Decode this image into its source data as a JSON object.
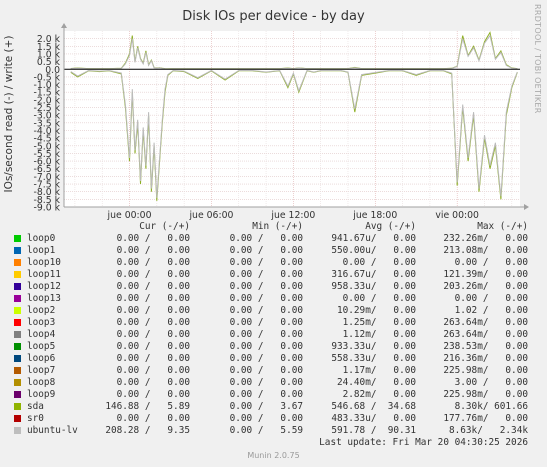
{
  "chart_data": {
    "type": "line",
    "title": "Disk IOs per device - by day",
    "ylabel": "IOs/second read (-) / write (+)",
    "y_ticks": [
      "2.0 k",
      "1.5 k",
      "1.0 k",
      "0.5 k",
      "0.0",
      "-0.5 k",
      "-1.0 k",
      "-1.5 k",
      "-2.0 k",
      "-2.5 k",
      "-3.0 k",
      "-3.5 k",
      "-4.0 k",
      "-4.5 k",
      "-5.0 k",
      "-5.5 k",
      "-6.0 k",
      "-6.5 k",
      "-7.0 k",
      "-7.5 k",
      "-8.0 k",
      "-8.5 k",
      "-9.0 k"
    ],
    "ylim": [
      -9000,
      2500
    ],
    "x_ticks": [
      "jue 00:00",
      "jue 06:00",
      "jue 12:00",
      "jue 18:00",
      "vie 00:00"
    ],
    "x_tick_hours": [
      0,
      6,
      12,
      18,
      24
    ],
    "xlim_hours": [
      -4.8,
      28.6
    ],
    "grid": true,
    "series": [
      {
        "name": "sda",
        "color": "#8fb026",
        "x_hours": [
          -4.3,
          -3.8,
          -3.0,
          -2.2,
          -1.5,
          -0.6,
          -0.3,
          0.0,
          0.2,
          0.4,
          0.6,
          0.8,
          1.0,
          1.2,
          1.4,
          1.6,
          1.8,
          2.0,
          2.2,
          2.4,
          2.6,
          2.8,
          3.2,
          4.0,
          5.0,
          6.0,
          7.0,
          8.0,
          9.0,
          10.0,
          11.0,
          11.6,
          12.0,
          12.4,
          13.0,
          13.5,
          14.0,
          15.5,
          16.0,
          16.5,
          17.0,
          19.0,
          20.0,
          21.0,
          22.0,
          23.0,
          23.6,
          24.0,
          24.4,
          24.8,
          25.2,
          25.6,
          26.0,
          26.4,
          26.8,
          27.2,
          27.6,
          28.0,
          28.4
        ],
        "read": [
          -200,
          -500,
          -100,
          -150,
          -100,
          -300,
          -2500,
          -6000,
          -1500,
          -5500,
          -3500,
          -7500,
          -4000,
          -6500,
          -3000,
          -8000,
          -5000,
          -8600,
          -6000,
          -3500,
          -1500,
          -400,
          -100,
          -150,
          -600,
          -100,
          -700,
          -100,
          -100,
          -200,
          -100,
          -1200,
          -300,
          -1500,
          -100,
          -200,
          -100,
          -100,
          -200,
          -2800,
          -400,
          -100,
          -100,
          -400,
          -100,
          -100,
          -300,
          -7600,
          -2500,
          -6000,
          -3000,
          -8000,
          -4500,
          -6500,
          -5000,
          -8500,
          -3000,
          -1200,
          -200
        ],
        "write": [
          50,
          80,
          40,
          40,
          40,
          60,
          400,
          1000,
          2200,
          500,
          1500,
          700,
          400,
          1200,
          300,
          600,
          100,
          80,
          100,
          60,
          40,
          30,
          40,
          40,
          40,
          40,
          40,
          40,
          40,
          40,
          40,
          80,
          40,
          90,
          40,
          50,
          40,
          40,
          40,
          120,
          40,
          40,
          40,
          40,
          40,
          40,
          60,
          200,
          2200,
          900,
          1500,
          600,
          1800,
          2400,
          700,
          1200,
          300,
          80,
          40
        ]
      },
      {
        "name": "ubuntu-lv",
        "color": "#bbbbbb",
        "x_hours": [
          -4.3,
          -3.8,
          -3.0,
          -2.2,
          -1.5,
          -0.6,
          -0.3,
          0.0,
          0.2,
          0.4,
          0.6,
          0.8,
          1.0,
          1.2,
          1.4,
          1.6,
          1.8,
          2.0,
          2.2,
          2.4,
          2.6,
          2.8,
          3.2,
          4.0,
          5.0,
          6.0,
          7.0,
          8.0,
          9.0,
          10.0,
          11.0,
          11.6,
          12.0,
          12.4,
          13.0,
          13.5,
          14.0,
          15.5,
          16.0,
          16.5,
          17.0,
          19.0,
          20.0,
          21.0,
          22.0,
          23.0,
          23.6,
          24.0,
          24.4,
          24.8,
          25.2,
          25.6,
          26.0,
          26.4,
          26.8,
          27.2,
          27.6,
          28.0,
          28.4
        ],
        "read": [
          -150,
          -450,
          -80,
          -120,
          -80,
          -250,
          -2300,
          -5800,
          -1300,
          -5300,
          -3300,
          -7300,
          -3800,
          -6300,
          -2800,
          -7800,
          -4800,
          -8400,
          -5800,
          -3300,
          -1300,
          -350,
          -80,
          -120,
          -550,
          -80,
          -650,
          -80,
          -80,
          -180,
          -80,
          -1100,
          -250,
          -1400,
          -80,
          -180,
          -80,
          -80,
          -180,
          -2600,
          -350,
          -80,
          -80,
          -350,
          -80,
          -80,
          -250,
          -7400,
          -2300,
          -5800,
          -2800,
          -7800,
          -4300,
          -6300,
          -4800,
          -8300,
          -2800,
          -1100,
          -180
        ],
        "write": [
          40,
          70,
          30,
          30,
          30,
          50,
          350,
          900,
          2000,
          450,
          1400,
          650,
          350,
          1100,
          250,
          550,
          90,
          70,
          90,
          50,
          30,
          20,
          30,
          30,
          30,
          30,
          30,
          30,
          30,
          30,
          30,
          70,
          30,
          80,
          30,
          40,
          30,
          30,
          30,
          100,
          30,
          30,
          30,
          30,
          30,
          30,
          50,
          180,
          2000,
          850,
          1400,
          550,
          1700,
          2200,
          650,
          1100,
          250,
          70,
          30
        ]
      }
    ]
  },
  "legend": {
    "headers": {
      "cur": "Cur (-/+)",
      "min": "Min (-/+)",
      "avg": "Avg (-/+)",
      "max": "Max (-/+)"
    },
    "rows": [
      {
        "name": "loop0",
        "color": "#00cc00",
        "cur": "0.00 /   0.00",
        "min": "0.00 /   0.00",
        "avg": "941.67u/   0.00",
        "max": "232.26m/   0.00"
      },
      {
        "name": "loop1",
        "color": "#0066b3",
        "cur": "0.00 /   0.00",
        "min": "0.00 /   0.00",
        "avg": "550.00u/   0.00",
        "max": "213.08m/   0.00"
      },
      {
        "name": "loop10",
        "color": "#ff8000",
        "cur": "0.00 /   0.00",
        "min": "0.00 /   0.00",
        "avg": "0.00 /   0.00",
        "max": "0.00 /   0.00"
      },
      {
        "name": "loop11",
        "color": "#ffcc00",
        "cur": "0.00 /   0.00",
        "min": "0.00 /   0.00",
        "avg": "316.67u/   0.00",
        "max": "121.39m/   0.00"
      },
      {
        "name": "loop12",
        "color": "#330099",
        "cur": "0.00 /   0.00",
        "min": "0.00 /   0.00",
        "avg": "958.33u/   0.00",
        "max": "203.26m/   0.00"
      },
      {
        "name": "loop13",
        "color": "#990099",
        "cur": "0.00 /   0.00",
        "min": "0.00 /   0.00",
        "avg": "0.00 /   0.00",
        "max": "0.00 /   0.00"
      },
      {
        "name": "loop2",
        "color": "#ccff00",
        "cur": "0.00 /   0.00",
        "min": "0.00 /   0.00",
        "avg": "10.29m/   0.00",
        "max": "1.02 /   0.00"
      },
      {
        "name": "loop3",
        "color": "#ff0000",
        "cur": "0.00 /   0.00",
        "min": "0.00 /   0.00",
        "avg": "1.25m/   0.00",
        "max": "263.64m/   0.00"
      },
      {
        "name": "loop4",
        "color": "#808080",
        "cur": "0.00 /   0.00",
        "min": "0.00 /   0.00",
        "avg": "1.12m/   0.00",
        "max": "263.64m/   0.00"
      },
      {
        "name": "loop5",
        "color": "#008f00",
        "cur": "0.00 /   0.00",
        "min": "0.00 /   0.00",
        "avg": "933.33u/   0.00",
        "max": "238.53m/   0.00"
      },
      {
        "name": "loop6",
        "color": "#00487d",
        "cur": "0.00 /   0.00",
        "min": "0.00 /   0.00",
        "avg": "558.33u/   0.00",
        "max": "216.36m/   0.00"
      },
      {
        "name": "loop7",
        "color": "#b35a00",
        "cur": "0.00 /   0.00",
        "min": "0.00 /   0.00",
        "avg": "1.17m/   0.00",
        "max": "225.98m/   0.00"
      },
      {
        "name": "loop8",
        "color": "#b38f00",
        "cur": "0.00 /   0.00",
        "min": "0.00 /   0.00",
        "avg": "24.40m/   0.00",
        "max": "3.00 /   0.00"
      },
      {
        "name": "loop9",
        "color": "#6b006b",
        "cur": "0.00 /   0.00",
        "min": "0.00 /   0.00",
        "avg": "2.82m/   0.00",
        "max": "225.98m/   0.00"
      },
      {
        "name": "sda",
        "color": "#8fb300",
        "cur": "146.88 /   5.89",
        "min": "0.00 /   3.67",
        "avg": "546.68 /  34.68",
        "max": "8.30k/ 601.66"
      },
      {
        "name": "sr0",
        "color": "#b30000",
        "cur": "0.00 /   0.00",
        "min": "0.00 /   0.00",
        "avg": "483.33u/   0.00",
        "max": "177.76m/   0.00"
      },
      {
        "name": "ubuntu-lv",
        "color": "#bebebe",
        "cur": "208.28 /   9.35",
        "min": "0.00 /   5.59",
        "avg": "591.78 /  90.31",
        "max": "8.63k/   2.34k"
      }
    ]
  },
  "last_update": "Last update: Fri Mar 20 04:30:25 2026",
  "watermark": "RRDTOOL / TOBI OETIKER",
  "footer": "Munin 2.0.75"
}
